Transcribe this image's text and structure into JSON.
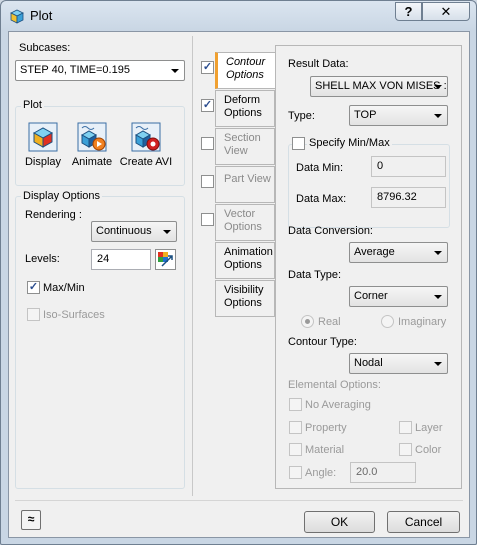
{
  "window": {
    "title": "Plot",
    "help_label": "?",
    "close_label": "✕"
  },
  "subcases": {
    "label": "Subcases:",
    "selected": "STEP 40, TIME=0.195"
  },
  "plot_group": {
    "title": "Plot",
    "display_label": "Display",
    "animate_label": "Animate",
    "create_avi_label": "Create AVI"
  },
  "display_options": {
    "title": "Display Options",
    "rendering_label": "Rendering :",
    "rendering_value": "Continuous",
    "levels_label": "Levels:",
    "levels_value": "24",
    "maxmin_label": "Max/Min",
    "maxmin_checked": true,
    "isosurfaces_label": "Iso-Surfaces",
    "isosurfaces_checked": false
  },
  "tabs": [
    {
      "label": "Contour Options",
      "line1": "Contour",
      "line2": "Options",
      "checked": true
    },
    {
      "label": "Deform Options",
      "line1": "Deform",
      "line2": "Options",
      "checked": true
    },
    {
      "label": "Section View",
      "line1": "Section",
      "line2": "View",
      "checked": false
    },
    {
      "label": "Part View",
      "line1": "Part View",
      "line2": "",
      "checked": false
    },
    {
      "label": "Vector Options",
      "line1": "Vector",
      "line2": "Options",
      "checked": false
    },
    {
      "label": "Animation Options",
      "line1": "Animation",
      "line2": "Options"
    },
    {
      "label": "Visibility Options",
      "line1": "Visibility",
      "line2": "Options"
    }
  ],
  "contour": {
    "result_data_label": "Result Data:",
    "result_data_value": "SHELL MAX VON MISES :",
    "type_label": "Type:",
    "type_value": "TOP",
    "specify_minmax_label": "Specify Min/Max",
    "specify_minmax_checked": false,
    "data_min_label": "Data Min:",
    "data_min_value": "0",
    "data_max_label": "Data Max:",
    "data_max_value": "8796.32",
    "data_conversion_label": "Data Conversion:",
    "data_conversion_value": "Average",
    "data_type_label": "Data Type:",
    "data_type_value": "Corner",
    "real_label": "Real",
    "imaginary_label": "Imaginary",
    "contour_type_label": "Contour Type:",
    "contour_type_value": "Nodal",
    "elemental_options_label": "Elemental Options:",
    "no_averaging_label": "No Averaging",
    "property_label": "Property",
    "layer_label": "Layer",
    "material_label": "Material",
    "color_label": "Color",
    "angle_label": "Angle:",
    "angle_value": "20.0"
  },
  "footer": {
    "expand_label": "≈",
    "ok_label": "OK",
    "cancel_label": "Cancel"
  }
}
